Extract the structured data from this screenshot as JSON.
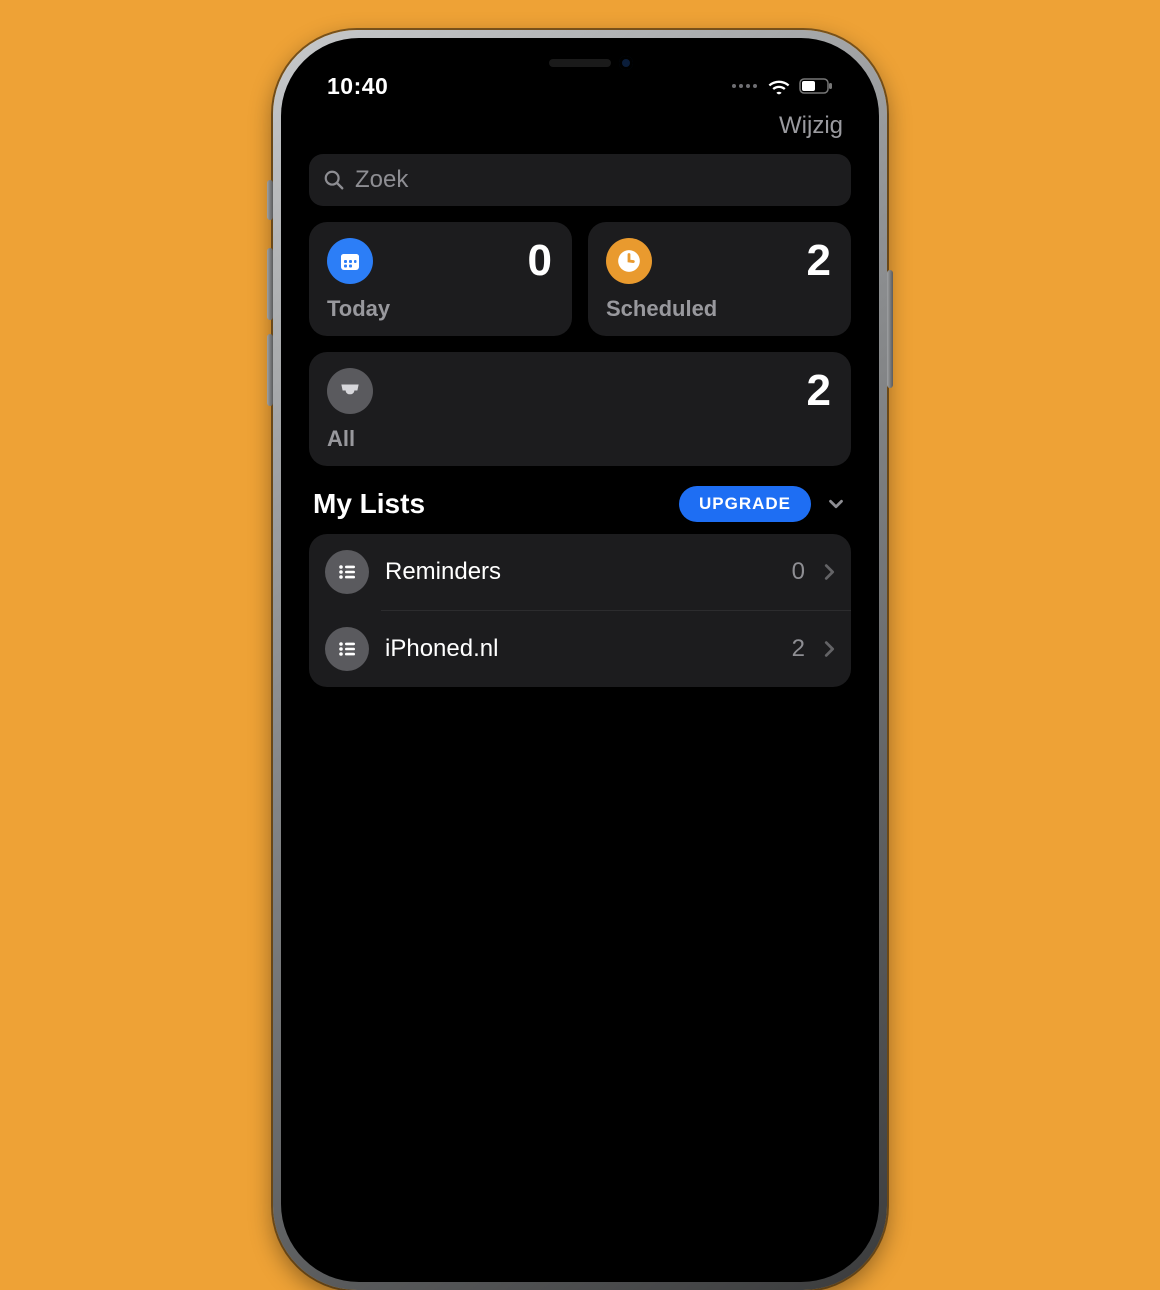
{
  "status": {
    "time": "10:40"
  },
  "nav": {
    "edit": "Wijzig"
  },
  "search": {
    "placeholder": "Zoek"
  },
  "cards": {
    "today": {
      "label": "Today",
      "count": "0"
    },
    "scheduled": {
      "label": "Scheduled",
      "count": "2"
    },
    "all": {
      "label": "All",
      "count": "2"
    }
  },
  "lists": {
    "title": "My Lists",
    "upgrade": "UPGRADE",
    "items": [
      {
        "name": "Reminders",
        "count": "0"
      },
      {
        "name": "iPhoned.nl",
        "count": "2"
      }
    ]
  },
  "colors": {
    "bg_page": "#eea236",
    "card_bg": "#1c1c1e",
    "accent_blue": "#1e6ef3",
    "icon_blue": "#2c7ef7",
    "icon_orange": "#e99a2e",
    "icon_grey": "#5a5a5e",
    "muted_text": "#8e8e93"
  }
}
